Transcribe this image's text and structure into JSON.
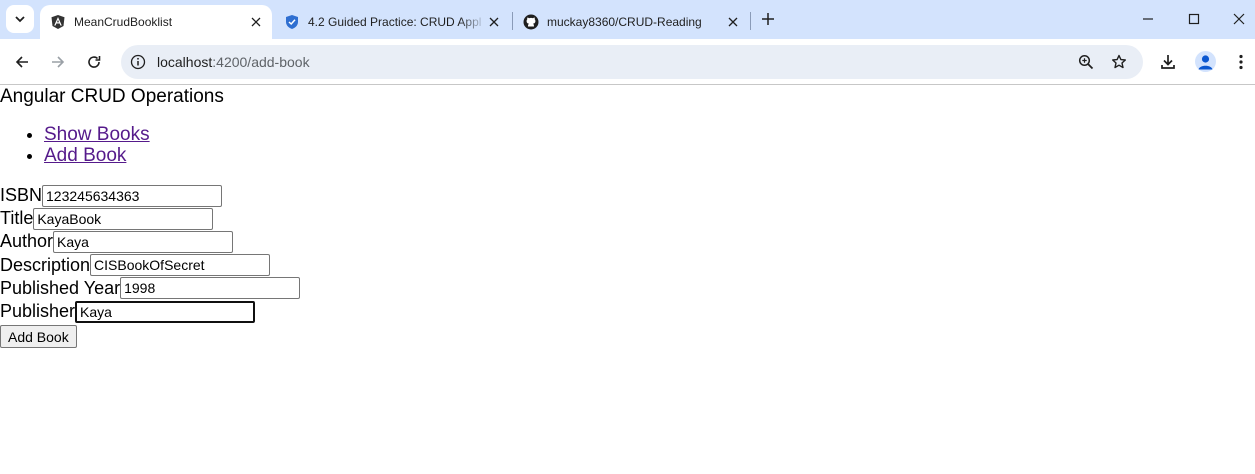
{
  "browser": {
    "tabs": [
      {
        "title": "MeanCrudBooklist",
        "favicon": "angular-icon",
        "active": true
      },
      {
        "title": "4.2 Guided Practice: CRUD Appl",
        "favicon": "shield-icon",
        "active": false
      },
      {
        "title": "muckay8360/CRUD-Reading",
        "favicon": "github-icon",
        "active": false
      }
    ],
    "url_host": "localhost",
    "url_path": ":4200/add-book",
    "accent_color": "#d3e3fd"
  },
  "page": {
    "heading": "Angular CRUD Operations",
    "nav": [
      {
        "label": "Show Books"
      },
      {
        "label": "Add Book"
      }
    ],
    "form": {
      "fields": [
        {
          "label": "ISBN",
          "value": "123245634363"
        },
        {
          "label": "Title",
          "value": "KayaBook"
        },
        {
          "label": "Author",
          "value": "Kaya"
        },
        {
          "label": "Description",
          "value": "CISBookOfSecret"
        },
        {
          "label": "Published Year",
          "value": "1998"
        },
        {
          "label": "Publisher",
          "value": "Kaya"
        }
      ],
      "submit_label": "Add Book"
    }
  }
}
